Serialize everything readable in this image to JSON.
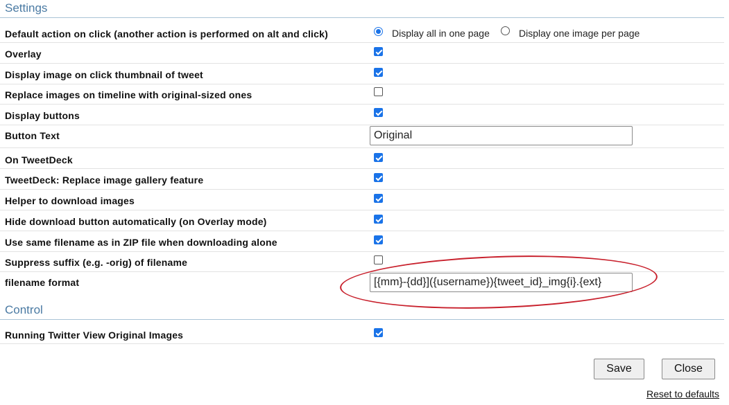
{
  "settings": {
    "title": "Settings",
    "default_action": {
      "label": "Default action on click (another action is performed on alt and click)",
      "option_all": "Display all in one page",
      "option_one": "Display one image per page",
      "selected": "option_all"
    },
    "rows": [
      {
        "label": "Overlay",
        "checked": true
      },
      {
        "label": "Display image on click thumbnail of tweet",
        "checked": true
      },
      {
        "label": "Replace images on timeline with original-sized ones",
        "checked": false
      },
      {
        "label": "Display buttons",
        "checked": true
      },
      {
        "label": "Button Text",
        "value": "Original"
      },
      {
        "label": "On TweetDeck",
        "checked": true
      },
      {
        "label": "TweetDeck: Replace image gallery feature",
        "checked": true
      },
      {
        "label": "Helper to download images",
        "checked": true
      },
      {
        "label": "Hide download button automatically (on Overlay mode)",
        "checked": true
      },
      {
        "label": "Use same filename as in ZIP file when downloading alone",
        "checked": true
      },
      {
        "label": "Suppress suffix (e.g. -orig) of filename",
        "checked": false
      },
      {
        "label": "filename format",
        "value": "[{mm}-{dd}]({username}){tweet_id}_img{i}.{ext}"
      }
    ]
  },
  "control": {
    "title": "Control",
    "rows": [
      {
        "label": "Running Twitter View Original Images",
        "checked": true
      }
    ]
  },
  "buttons": {
    "save_label": "Save",
    "close_label": "Close",
    "reset_label": "Reset to defaults"
  },
  "colors": {
    "section_title": "#4a7aa3",
    "accent": "#1a73e8",
    "annotation": "#c8202c"
  }
}
